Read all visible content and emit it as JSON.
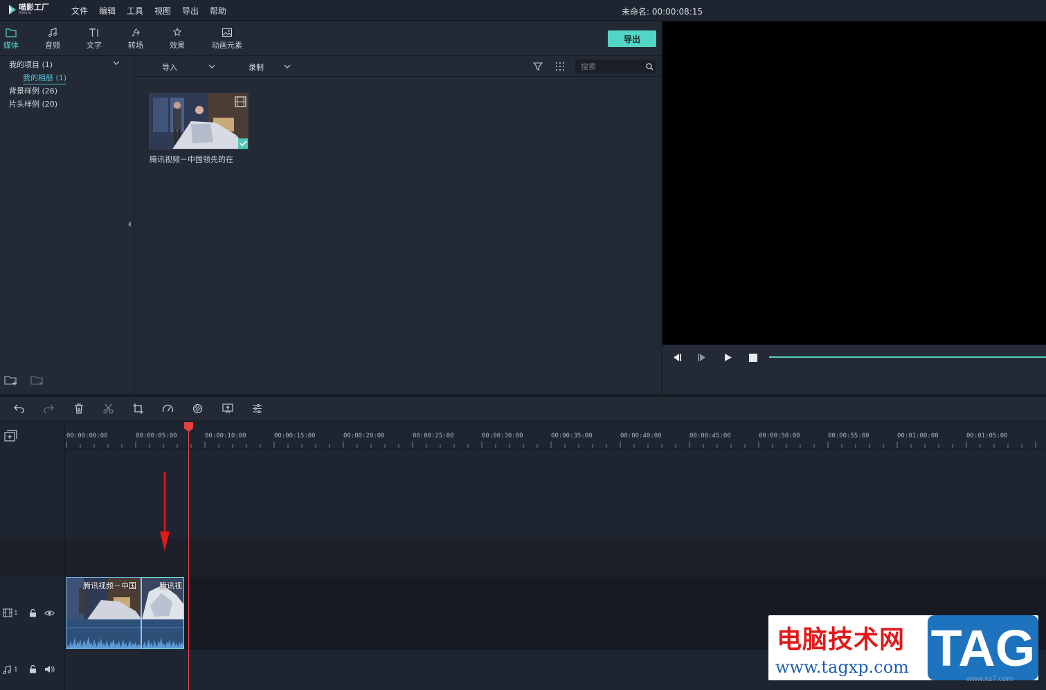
{
  "app": {
    "logo_name": "喵影工厂",
    "logo_sub": "filmora"
  },
  "menu": [
    "文件",
    "编辑",
    "工具",
    "视图",
    "导出",
    "帮助"
  ],
  "project_title": "未命名: 00:00:08:15",
  "tabs": [
    {
      "label": "媒体",
      "icon": "folder-icon",
      "active": true
    },
    {
      "label": "音频",
      "icon": "music-note-icon"
    },
    {
      "label": "文字",
      "icon": "text-icon"
    },
    {
      "label": "转场",
      "icon": "transition-icon"
    },
    {
      "label": "效果",
      "icon": "effects-icon"
    },
    {
      "label": "动画元素",
      "icon": "image-icon"
    }
  ],
  "export_label": "导出",
  "tree": {
    "my_project": "我的项目 (1)",
    "my_album": "我的相册 (1)",
    "bg_samples": "背景样例 (26)",
    "intro_samples": "片头样例 (20)"
  },
  "media_toolbar": {
    "import_label": "导入",
    "record_label": "录制",
    "search_placeholder": "搜索"
  },
  "media_items": [
    {
      "label": "腾讯视频－中国领先的在"
    }
  ],
  "timeline": {
    "ticks": [
      "00:00:00:00",
      "00:00:05:00",
      "00:00:10:00",
      "00:00:15:00",
      "00:00:20:00",
      "00:00:25:00",
      "00:00:30:00",
      "00:00:35:00",
      "00:00:40:00",
      "00:00:45:00",
      "00:00:50:00",
      "00:00:55:00",
      "00:01:00:00",
      "00:01:05:00"
    ],
    "video_track_num": "1",
    "audio_track_num": "1",
    "clips": [
      {
        "title": "腾讯视频－中国"
      },
      {
        "title": "腾讯视"
      }
    ]
  },
  "watermark": {
    "cn": "电脑技术网",
    "url": "www.tagxp.com",
    "tag": "TAG",
    "sub": "www.xz7.com"
  },
  "colors": {
    "accent": "#54d6c6",
    "playhead": "#e8403f",
    "bg": "#232a35"
  }
}
